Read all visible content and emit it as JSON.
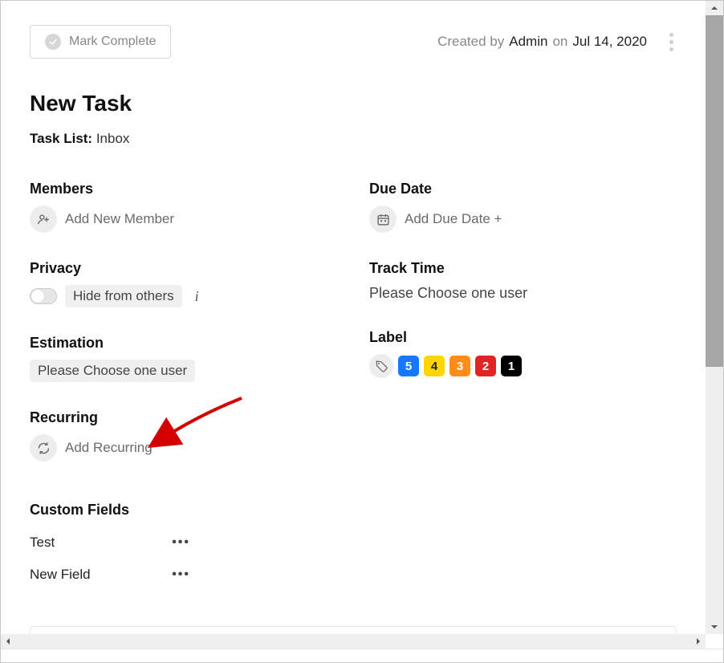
{
  "header": {
    "mark_complete": "Mark Complete",
    "created_by_label": "Created by",
    "created_by_user": "Admin",
    "created_on_label": "on",
    "created_date": "Jul 14, 2020"
  },
  "title": "New Task",
  "tasklist": {
    "label": "Task List:",
    "value": "Inbox"
  },
  "members": {
    "heading": "Members",
    "add_label": "Add New Member"
  },
  "privacy": {
    "heading": "Privacy",
    "hide_label": "Hide from others"
  },
  "estimation": {
    "heading": "Estimation",
    "placeholder": "Please Choose one user"
  },
  "recurring": {
    "heading": "Recurring",
    "add_label": "Add Recurring"
  },
  "due_date": {
    "heading": "Due Date",
    "add_label": "Add Due Date +"
  },
  "track_time": {
    "heading": "Track Time",
    "placeholder": "Please Choose one user"
  },
  "label": {
    "heading": "Label",
    "chips": [
      {
        "text": "5",
        "bg": "#1677ff"
      },
      {
        "text": "4",
        "bg": "#ffd600",
        "fg": "#222"
      },
      {
        "text": "3",
        "bg": "#ff8c1a"
      },
      {
        "text": "2",
        "bg": "#e02424"
      },
      {
        "text": "1",
        "bg": "#000000"
      }
    ]
  },
  "custom_fields": {
    "heading": "Custom Fields",
    "rows": [
      {
        "name": "Test"
      },
      {
        "name": "New Field"
      }
    ]
  }
}
